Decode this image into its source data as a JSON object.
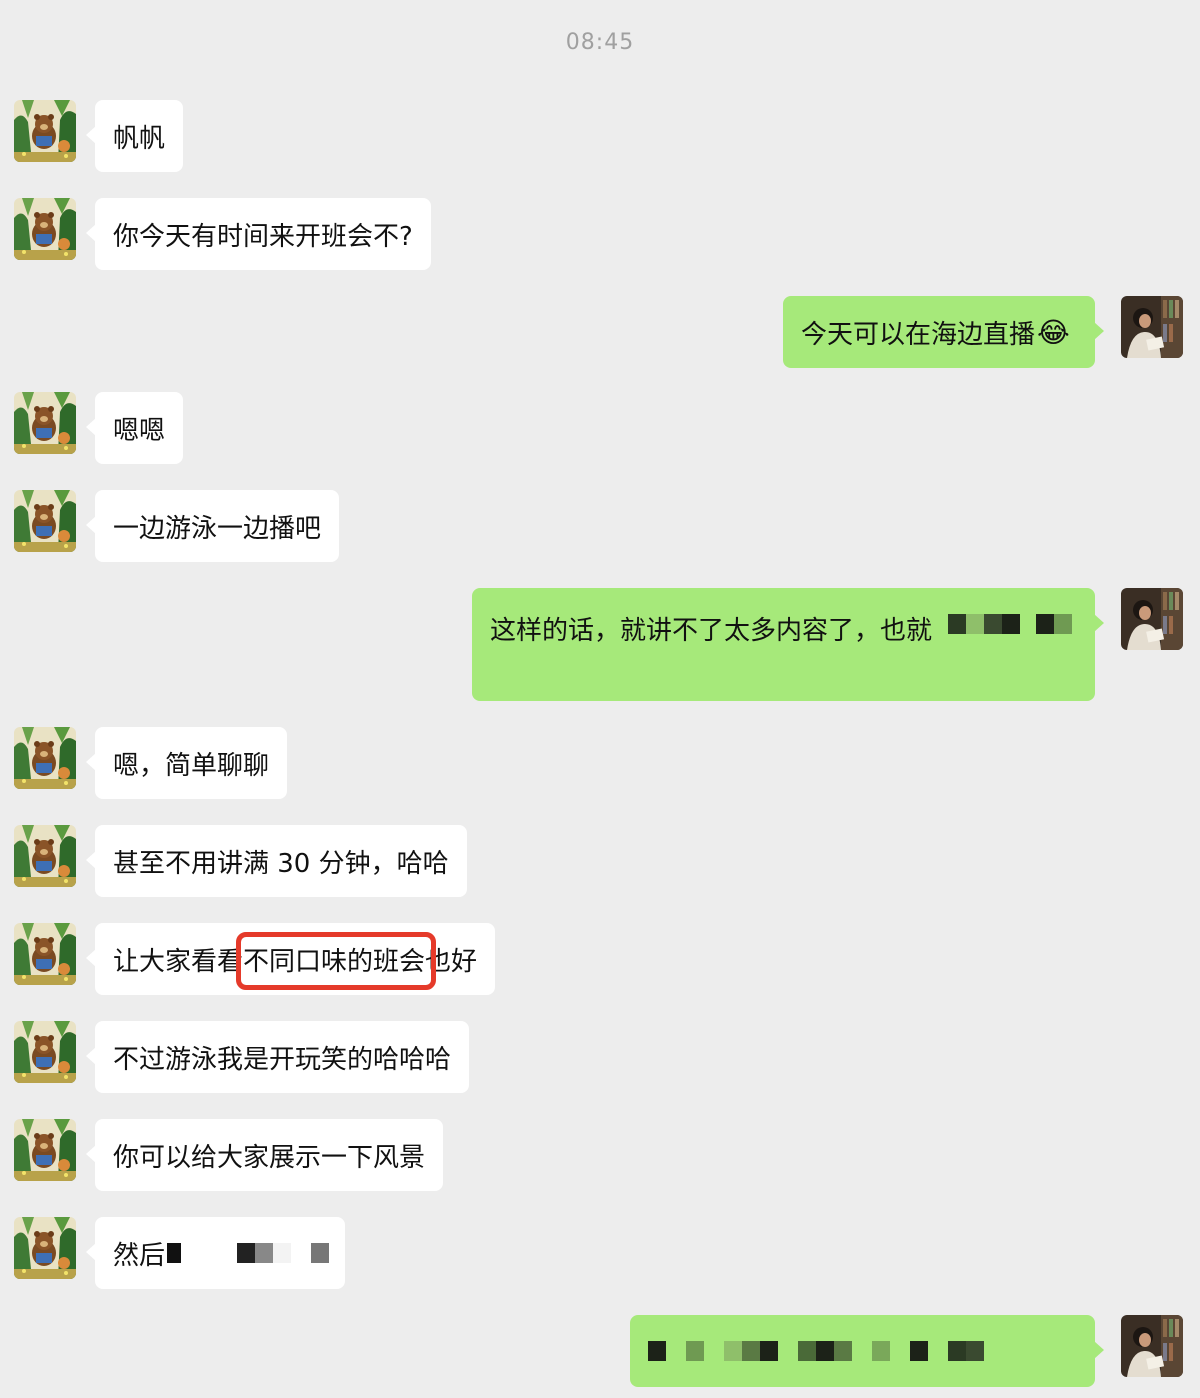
{
  "timestamp": "08:45",
  "messages": [
    {
      "side": "left",
      "text": "帆帆"
    },
    {
      "side": "left",
      "text": "你今天有时间来开班会不?"
    },
    {
      "side": "right",
      "text": "今天可以在海边直播",
      "emoji": "😂"
    },
    {
      "side": "left",
      "text": "嗯嗯"
    },
    {
      "side": "left",
      "text": "一边游泳一边播吧"
    },
    {
      "side": "right",
      "text": "这样的话，就讲不了太多内容了，也就"
    },
    {
      "side": "left",
      "text": "嗯，简单聊聊"
    },
    {
      "side": "left",
      "text": "甚至不用讲满 30 分钟，哈哈"
    },
    {
      "side": "left",
      "text": "让大家看看不同口味的班会也好"
    },
    {
      "side": "left",
      "text": "不过游泳我是开玩笑的哈哈哈"
    },
    {
      "side": "left",
      "text": "你可以给大家展示一下风景"
    },
    {
      "side": "left",
      "text": "然后"
    },
    {
      "side": "right",
      "text": ""
    }
  ]
}
